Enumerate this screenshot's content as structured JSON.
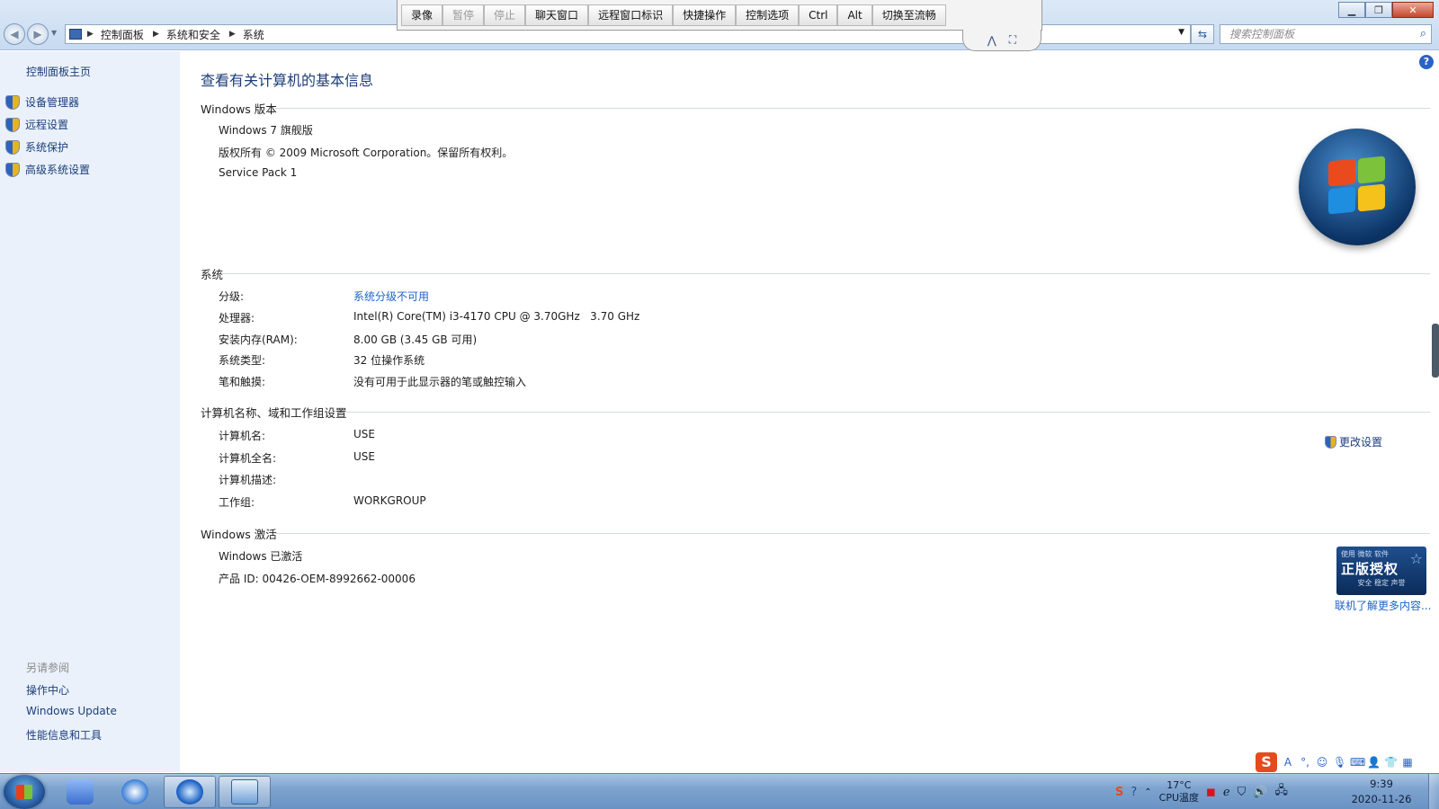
{
  "address": {
    "crumbs": [
      "控制面板",
      "系统和安全",
      "系统"
    ],
    "search_placeholder": "搜索控制面板"
  },
  "remote_toolbar": {
    "buttons": [
      "录像",
      "暂停",
      "停止",
      "聊天窗口",
      "远程窗口标识",
      "快捷操作",
      "控制选项",
      "Ctrl",
      "Alt",
      "切换至流畅"
    ]
  },
  "sidebar": {
    "home": "控制面板主页",
    "items": [
      "设备管理器",
      "远程设置",
      "系统保护",
      "高级系统设置"
    ],
    "see_also_title": "另请参阅",
    "see_also": [
      "操作中心",
      "Windows Update",
      "性能信息和工具"
    ]
  },
  "main": {
    "title": "查看有关计算机的基本信息",
    "edition": {
      "heading": "Windows 版本",
      "name": "Windows 7 旗舰版",
      "copyright": "版权所有 © 2009 Microsoft Corporation。保留所有权利。",
      "service_pack": "Service Pack 1"
    },
    "system": {
      "heading": "系统",
      "rows": [
        {
          "label": "分级:",
          "value": "系统分级不可用"
        },
        {
          "label": "处理器:",
          "value": "Intel(R) Core(TM) i3-4170 CPU @ 3.70GHz   3.70 GHz"
        },
        {
          "label": "安装内存(RAM):",
          "value": "8.00 GB (3.45 GB 可用)"
        },
        {
          "label": "系统类型:",
          "value": "32 位操作系统"
        },
        {
          "label": "笔和触摸:",
          "value": "没有可用于此显示器的笔或触控输入"
        }
      ]
    },
    "computer": {
      "heading": "计算机名称、域和工作组设置",
      "change_settings": "更改设置",
      "rows": [
        {
          "label": "计算机名:",
          "value": "USE"
        },
        {
          "label": "计算机全名:",
          "value": "USE"
        },
        {
          "label": "计算机描述:",
          "value": ""
        },
        {
          "label": "工作组:",
          "value": "WORKGROUP"
        }
      ]
    },
    "activation": {
      "heading": "Windows 激活",
      "status": "Windows 已激活",
      "product_id": "产品 ID: 00426-OEM-8992662-00006",
      "badge": {
        "top": "使用 微软 软件",
        "main": "正版授权",
        "sub": "安全 稳定 声誉"
      },
      "more_link": "联机了解更多内容..."
    }
  },
  "taskbar": {
    "temperature": "17°C",
    "temperature_label": "CPU温度",
    "time": "9:39",
    "date": "2020-11-26"
  },
  "colors": {
    "link": "#1c64c8",
    "sidebar_bg": "#eaf1fa",
    "title": "#1c3e7a"
  }
}
